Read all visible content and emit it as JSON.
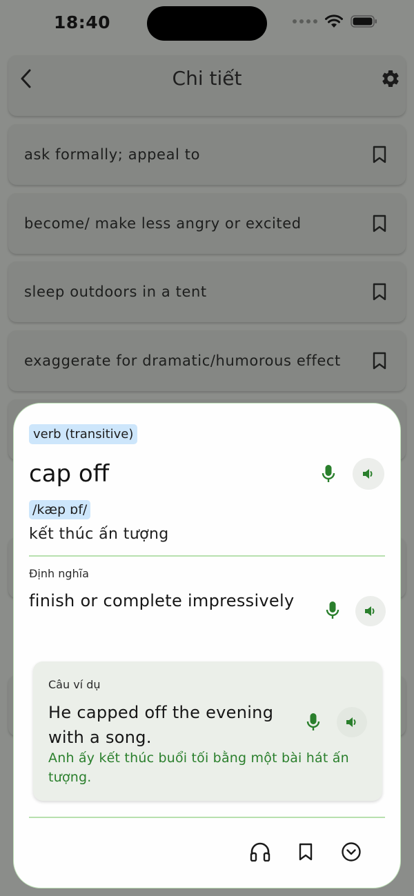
{
  "status_bar": {
    "time": "18:40"
  },
  "header": {
    "title": "Chi tiết",
    "back_icon": "chevron-left-icon",
    "settings_icon": "gear-icon"
  },
  "list": {
    "items": [
      {
        "text": "ask formally; appeal to"
      },
      {
        "text": "become/ make less angry or excited"
      },
      {
        "text": "sleep outdoors in a tent"
      },
      {
        "text": "exaggerate for dramatic/humorous effect"
      }
    ]
  },
  "detail": {
    "part_of_speech": "verb (transitive)",
    "word": "cap off",
    "ipa": "/kæp ɒf/",
    "meaning_vi": "kết thúc ấn tượng",
    "definition_label": "Định nghĩa",
    "definition": "finish or complete impressively",
    "example_label": "Câu ví dụ",
    "example": "He capped off the evening with a song.",
    "example_translation": "Anh ấy kết thúc buổi tối bằng một bài hát ấn tượng."
  },
  "colors": {
    "accent_green": "#2a7f2c",
    "tag_blue": "#cde6fb",
    "divider_green": "#b7e0ae",
    "overlay": "#8b8d8a"
  },
  "icons": {
    "mic": "microphone-icon",
    "speaker": "speaker-icon",
    "bookmark": "bookmark-icon",
    "headphones": "headphones-icon",
    "expand": "chevron-down-circle-icon"
  }
}
